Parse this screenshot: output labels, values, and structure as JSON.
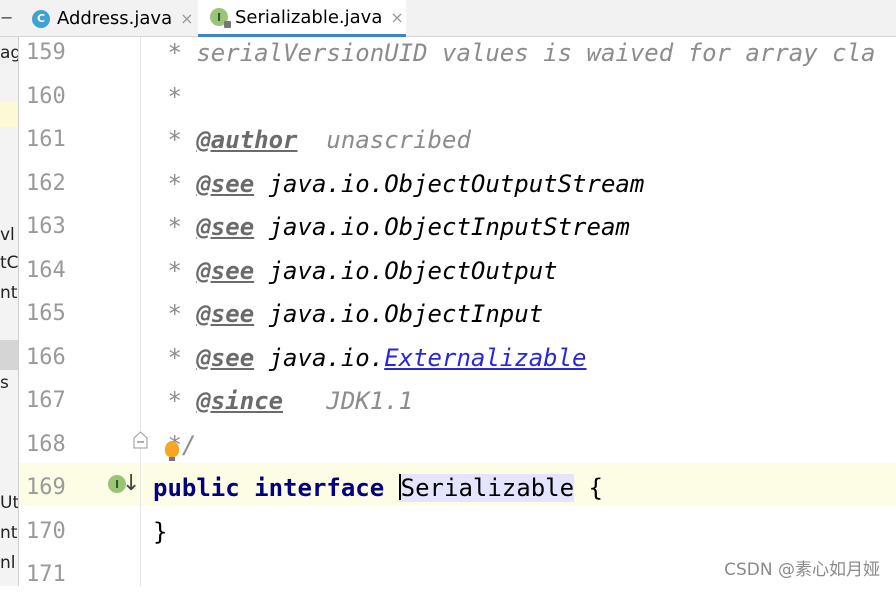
{
  "tabs": [
    {
      "icon": "class-icon",
      "icon_letter": "C",
      "label": "Address.java",
      "close": "×"
    },
    {
      "icon": "interface-icon",
      "icon_letter": "I",
      "label": "Serializable.java",
      "close": "×",
      "active": true
    }
  ],
  "tab_collapse": "−",
  "left_panel": {
    "fragments": [
      "ag",
      "vl",
      "tC",
      "ntr",
      "s",
      "Ut",
      "nts",
      "nl"
    ]
  },
  "gutter": {
    "line_numbers": [
      "159",
      "160",
      "161",
      "162",
      "163",
      "164",
      "165",
      "166",
      "167",
      "168",
      "169",
      "170",
      "171"
    ],
    "implemented_marker": "I",
    "down_arrow": "↓"
  },
  "code": {
    "l159": {
      "star": " * ",
      "text": "serialVersionUID values is waived for array cla"
    },
    "l160": {
      "star": " *"
    },
    "l161": {
      "star": " * ",
      "tag": "@author",
      "text": "  unascribed"
    },
    "l162": {
      "star": " * ",
      "tag": "@see",
      "ref": " java.io.ObjectOutputStream"
    },
    "l163": {
      "star": " * ",
      "tag": "@see",
      "ref": " java.io.ObjectInputStream"
    },
    "l164": {
      "star": " * ",
      "tag": "@see",
      "ref": " java.io.ObjectOutput"
    },
    "l165": {
      "star": " * ",
      "tag": "@see",
      "ref": " java.io.ObjectInput"
    },
    "l166": {
      "star": " * ",
      "tag": "@see",
      "ref": " java.io.",
      "link": "Externalizable"
    },
    "l167": {
      "star": " * ",
      "tag": "@since",
      "text": "   JDK1.1"
    },
    "l168": {
      "star": " */"
    },
    "l169": {
      "kw1": "public",
      "kw2": "interface",
      "ident": "Serializable",
      "rest": " {"
    },
    "l170": {
      "text": "}"
    }
  },
  "watermark": "CSDN @素心如月娅",
  "colors": {
    "keyword": "#000080",
    "comment": "#8c8c8c",
    "link": "#2a26d9",
    "current_line": "#fdfce4",
    "tab_accent": "#4083c9"
  }
}
